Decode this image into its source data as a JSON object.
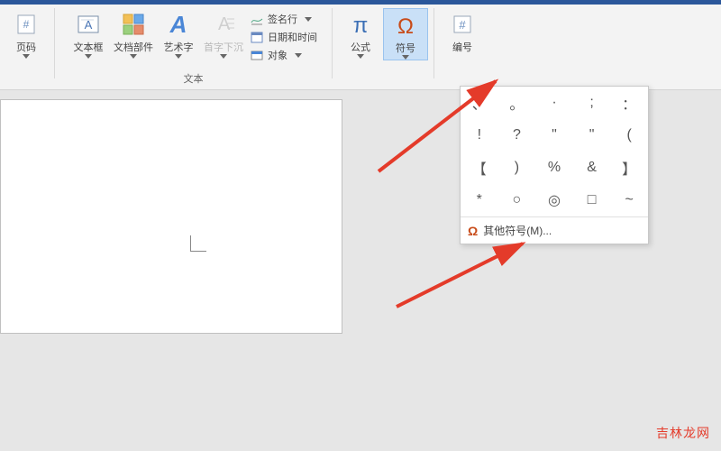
{
  "ribbon": {
    "pageNumber": {
      "label": "页码"
    },
    "textBox": {
      "label": "文本框"
    },
    "quickParts": {
      "label": "文档部件"
    },
    "wordArt": {
      "label": "艺术字"
    },
    "dropCap": {
      "label": "首字下沉"
    },
    "textGroupLabel": "文本",
    "signatureLine": {
      "label": "签名行"
    },
    "dateTime": {
      "label": "日期和时间"
    },
    "object": {
      "label": "对象"
    },
    "equation": {
      "label": "公式"
    },
    "symbol": {
      "label": "符号"
    },
    "number": {
      "label": "编号"
    }
  },
  "symbolPanel": {
    "cells": [
      [
        "、",
        "。",
        "·",
        ";",
        "："
      ],
      [
        "!",
        "?",
        "\"",
        "\"",
        "("
      ],
      [
        "【",
        ")",
        "%",
        "&",
        "】"
      ],
      [
        "*",
        "○",
        "◎",
        "□",
        "~"
      ]
    ],
    "moreLabel": "其他符号(M)..."
  },
  "watermark": "吉林龙网"
}
